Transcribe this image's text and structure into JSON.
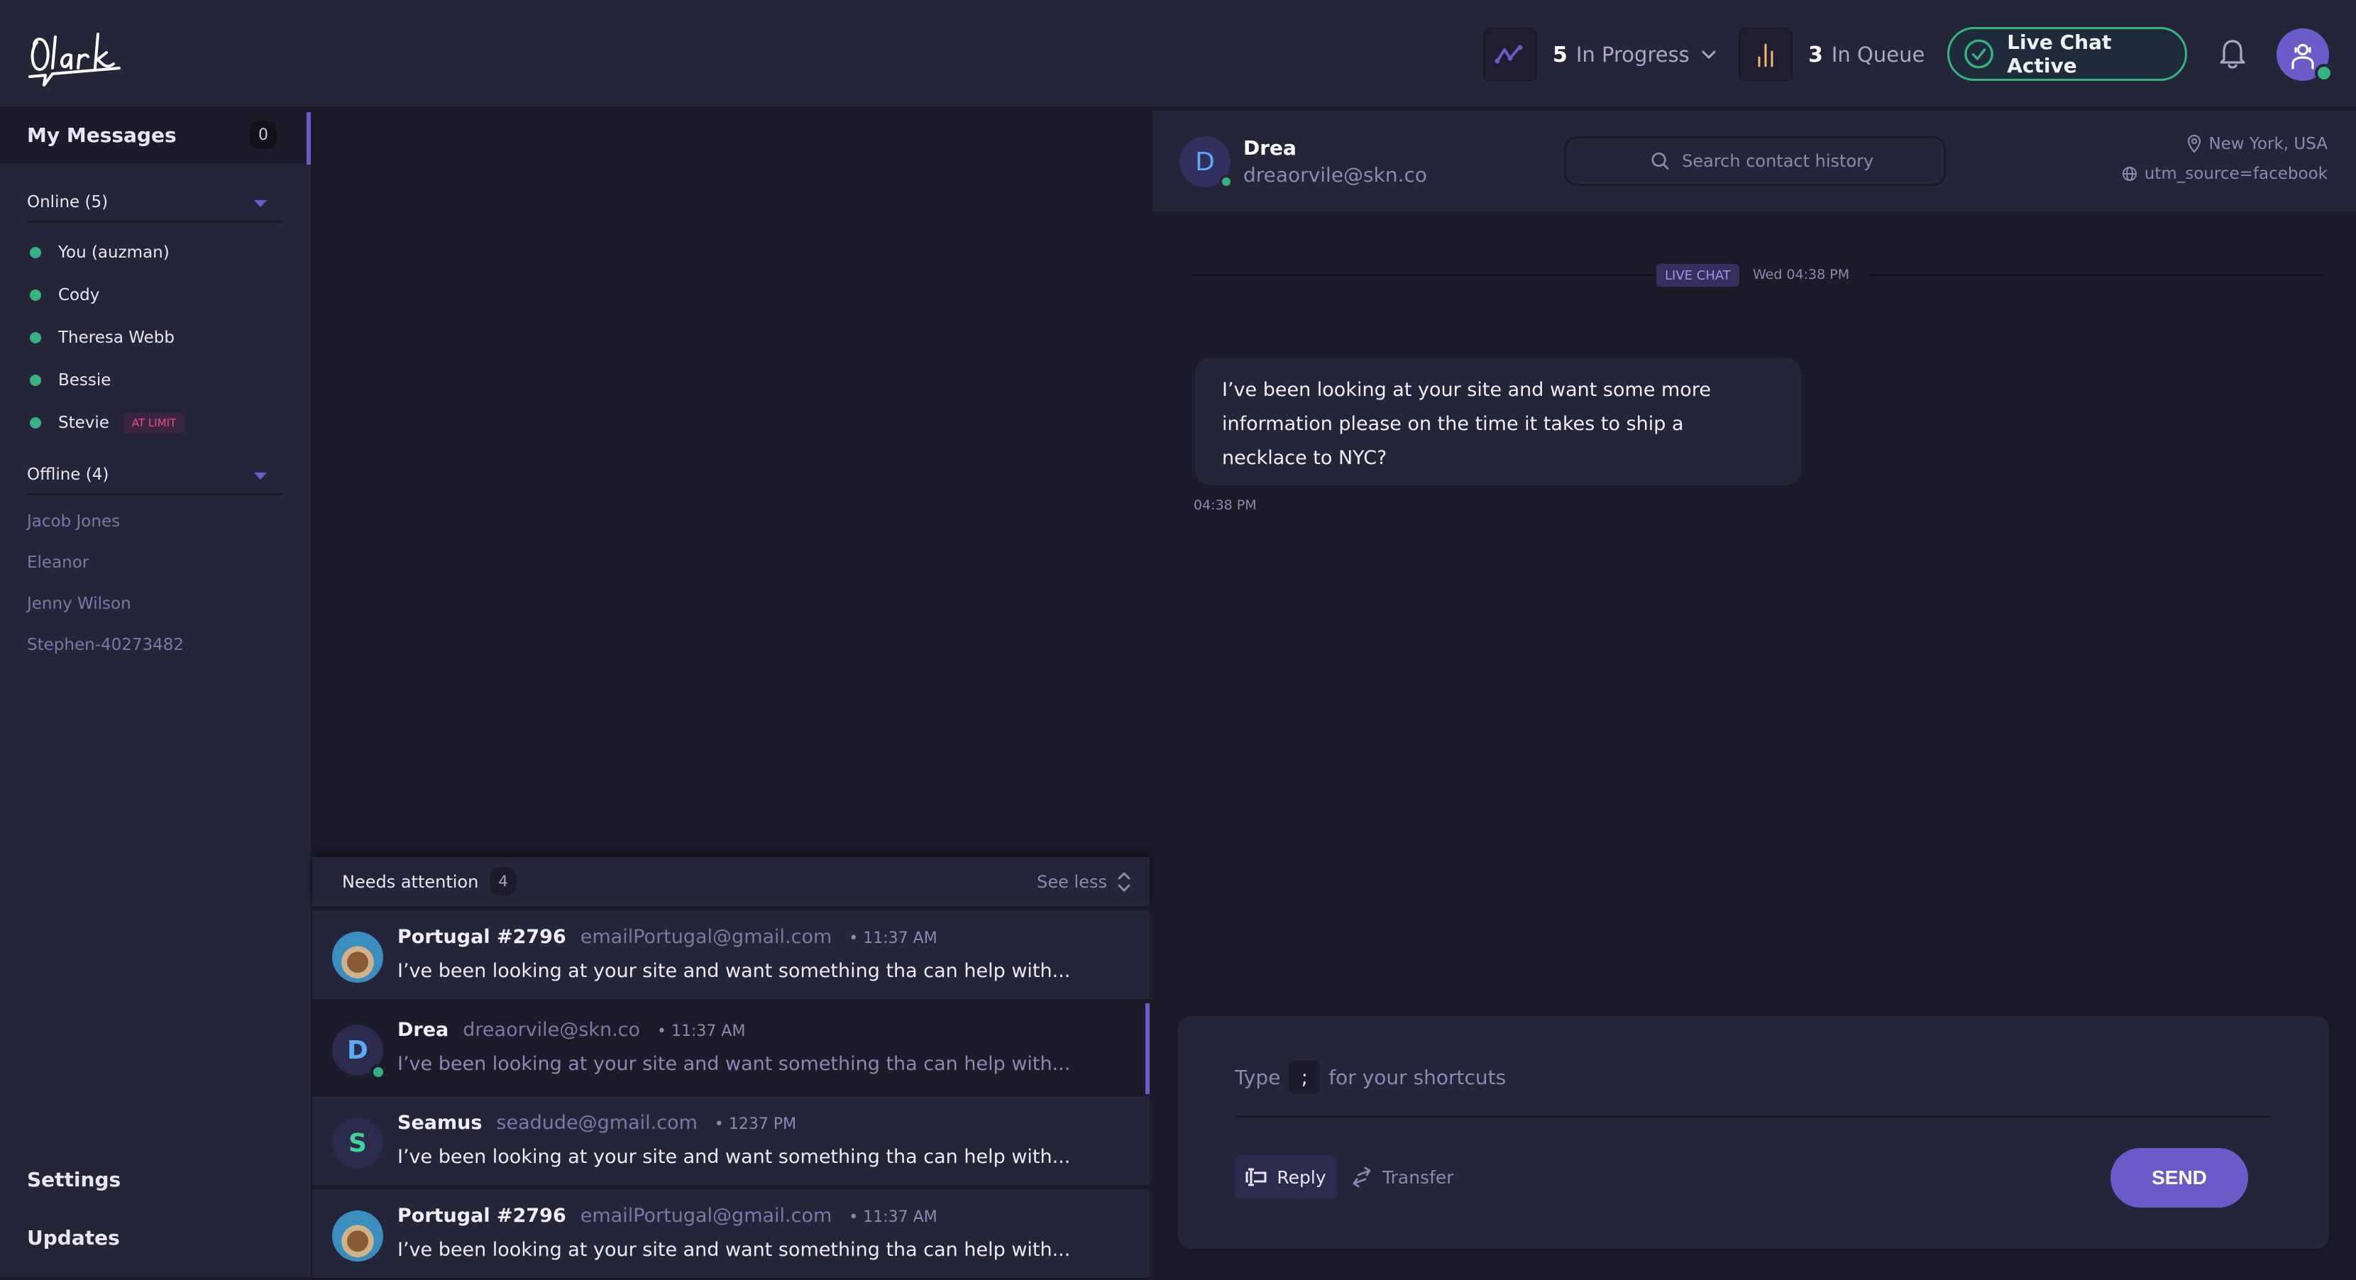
{
  "header": {
    "logo_text": "Olark",
    "in_progress": {
      "count": "5",
      "label": "In Progress"
    },
    "in_queue": {
      "count": "3",
      "label": "In Queue"
    },
    "live_chat_status": "Live Chat Active",
    "colors": {
      "accent": "#6a5bc8",
      "online": "#35b27f",
      "queue_icon": "#f5b66b"
    }
  },
  "sidebar": {
    "my_messages": {
      "label": "My Messages",
      "count": "0"
    },
    "online_group": {
      "label": "Online (5)",
      "agents": [
        {
          "name": "You (auzman)"
        },
        {
          "name": "Cody"
        },
        {
          "name": "Theresa Webb"
        },
        {
          "name": "Bessie"
        },
        {
          "name": "Stevie",
          "badge": "AT LIMIT"
        }
      ]
    },
    "offline_group": {
      "label": "Offline (4)",
      "agents": [
        {
          "name": "Jacob Jones"
        },
        {
          "name": "Eleanor"
        },
        {
          "name": "Jenny Wilson"
        },
        {
          "name": "Stephen-40273482"
        }
      ]
    },
    "settings_label": "Settings",
    "updates_label": "Updates"
  },
  "needs_attention": {
    "label": "Needs attention",
    "count": "4",
    "toggle_label": "See less",
    "conversations": [
      {
        "name": "Portugal #2796",
        "email": "emailPortugal@gmail.com",
        "time": "• 11:37 AM",
        "preview": "I’ve been looking at your site and want something tha can help with...",
        "avatar": "photo"
      },
      {
        "name": "Drea",
        "email": "dreaorvile@skn.co",
        "time": "• 11:37 AM",
        "preview": "I’ve been looking at your site and want something tha can help with...",
        "avatar": "D",
        "active": true
      },
      {
        "name": "Seamus",
        "email": "seadude@gmail.com",
        "time": "• 1237 PM",
        "preview": "I’ve been looking at your site and want something tha can help with...",
        "avatar": "S"
      },
      {
        "name": "Portugal #2796",
        "email": "emailPortugal@gmail.com",
        "time": "• 11:37 AM",
        "preview": "I’ve been looking at your site and want something tha can help with...",
        "avatar": "photo"
      }
    ]
  },
  "contact": {
    "initial": "D",
    "name": "Drea",
    "email": "dreaorvile@skn.co",
    "search_placeholder": "Search contact history",
    "location": "New York, USA",
    "utm": "utm_source=facebook"
  },
  "chat": {
    "channel_tag": "LIVE CHAT",
    "stamp": "Wed  04:38 PM",
    "messages": [
      {
        "text": "I’ve been looking at your site and want some more information please on the time it takes to ship a necklace to NYC?",
        "time": "04:38 PM"
      }
    ]
  },
  "composer": {
    "placeholder_prefix": "Type",
    "shortcut_key": ";",
    "placeholder_suffix": "for your shortcuts",
    "reply_label": "Reply",
    "transfer_label": "Transfer",
    "send_label": "SEND"
  }
}
